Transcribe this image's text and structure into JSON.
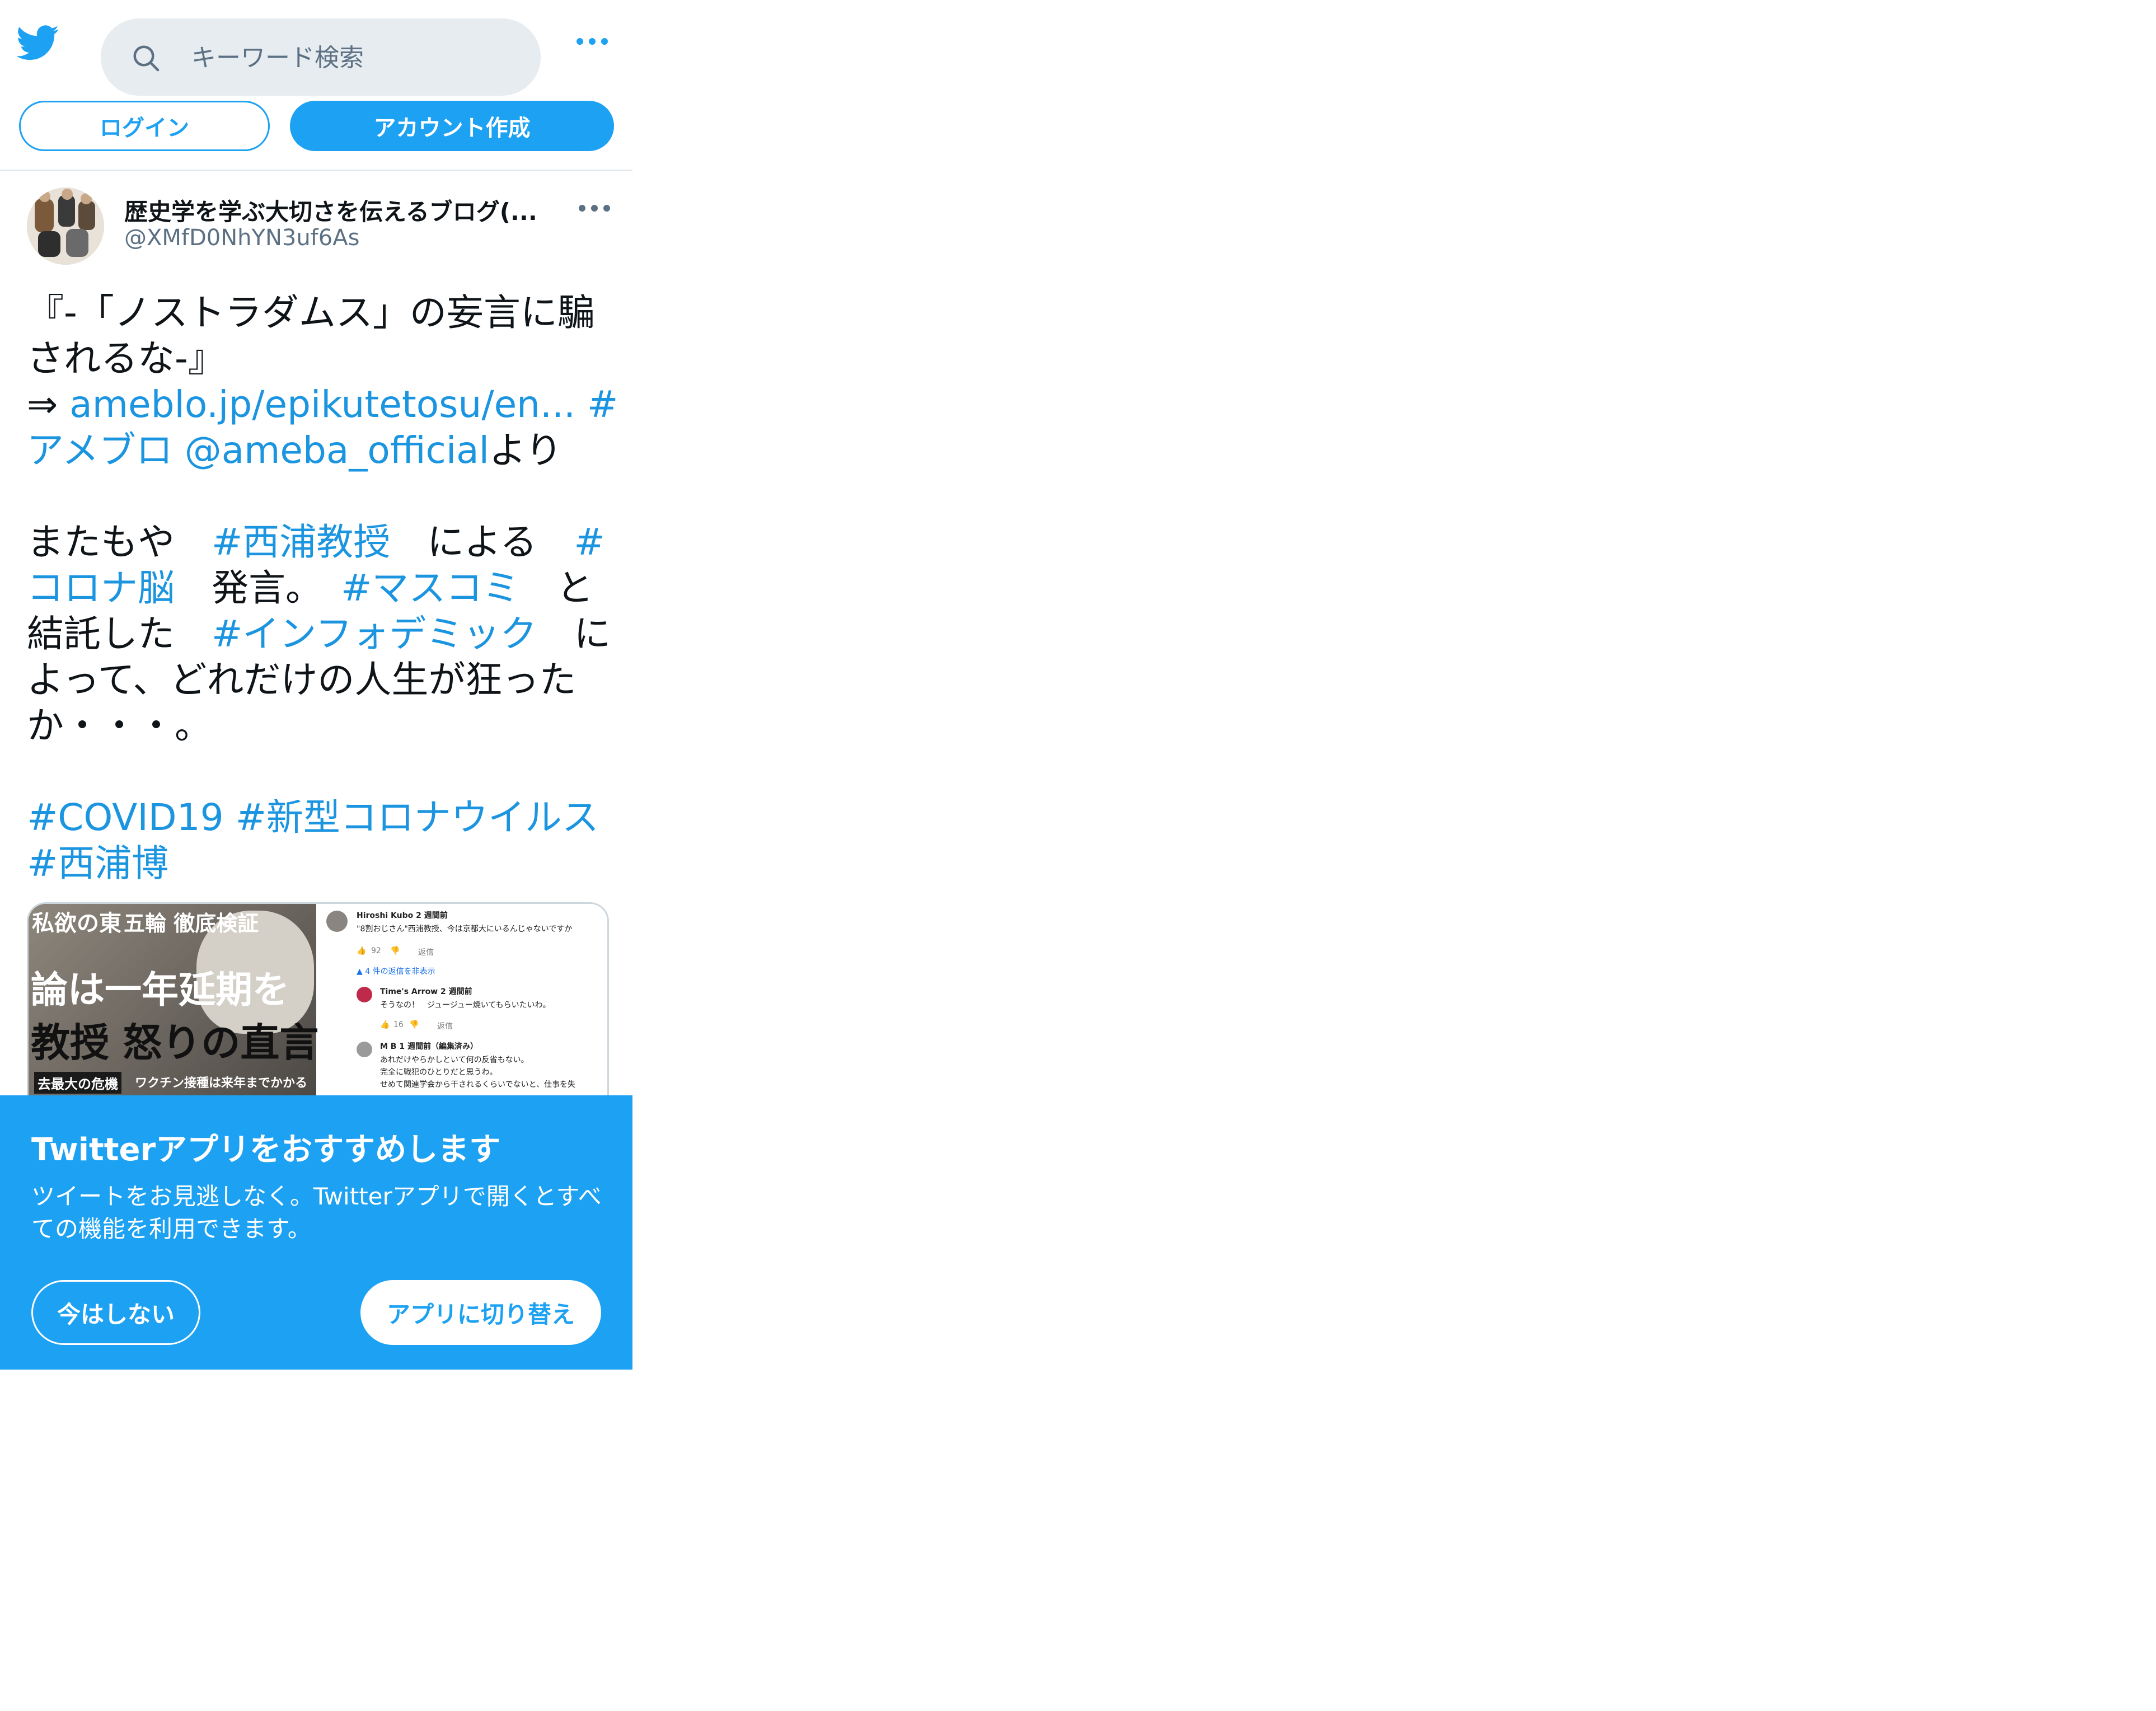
{
  "header": {
    "search_placeholder": "キーワード検索",
    "login_label": "ログイン",
    "signup_label": "アカウント作成"
  },
  "tweet": {
    "author_name": "歴史学を学ぶ大切さを伝えるブログ(...",
    "author_handle": "@XMfD0NhYN3uf6As",
    "line1": "『-「ノストラダムス」の妄言に騙されるな-』",
    "arrow": "⇒ ",
    "link": "ameblo.jp/epikutetosu/en...",
    "tag_ameblo": "#アメブロ",
    "mention": "@ameba_official",
    "yori": "より",
    "p2_a": "またもや　",
    "tag_nishiura_kyoju": "#西浦教授",
    "p2_b": "　による　",
    "tag_corona_brain": "#コロナ脳",
    "p2_c": "　発言。　",
    "tag_masukomi": "#マスコミ",
    "p2_d": "　と結託した　",
    "tag_infodemic": "#インフォデミック",
    "p2_e": "　によって、どれだけの人生が狂ったか・・・。",
    "tag_covid": "#COVID19",
    "tag_shingata": "#新型コロナウイルス",
    "tag_nishiura_hiroshi": "#西浦博"
  },
  "media": {
    "magazine": {
      "headline1": "論は一年延期を",
      "headline2": "教授 怒りの直言",
      "kicker": "五輪 徹底検証",
      "corner": "私欲の東",
      "banner": "去最大の危機",
      "sub": "ワクチン接種は来年までかかる"
    },
    "comments": [
      {
        "author": "Hiroshi Kubo 2 週間前",
        "text": "\"8割おじさん\"西浦教授、今は京都大にいるんじゃないですか",
        "likes": "92",
        "reply": "返信"
      },
      {
        "toggle": "▲ 4 件の返信を非表示"
      },
      {
        "author": "Time's Arrow 2 週間前",
        "text": "そうなの！　ジュージュー焼いてもらいたいわ。",
        "likes": "16",
        "reply": "返信"
      },
      {
        "author": "M B 1 週間前（編集済み）",
        "text": "あれだけやらかしといて何の反省もない。",
        "text2": "完全に戦犯のひとりだと思うわ。",
        "text3": "せめて関連学会から干されるくらいでないと、仕事を失"
      }
    ]
  },
  "app_banner": {
    "title": "Twitterアプリをおすすめします",
    "description": "ツイートをお見逃しなく。Twitterアプリで開くとすべての機能を利用できます。",
    "not_now": "今はしない",
    "switch": "アプリに切り替え"
  }
}
